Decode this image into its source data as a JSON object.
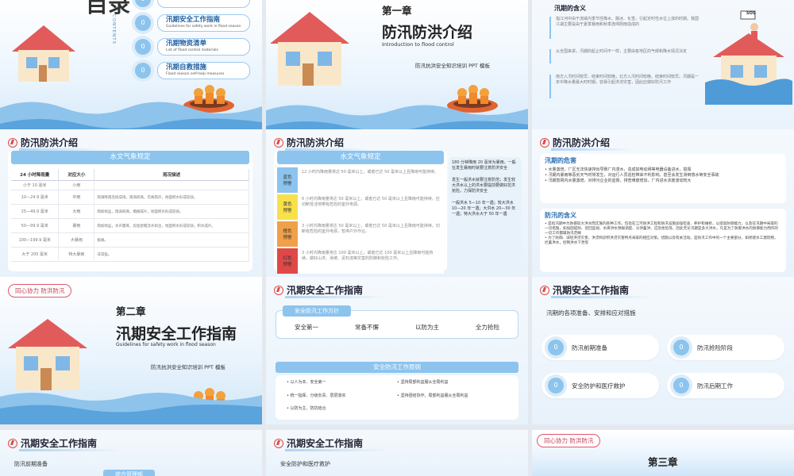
{
  "s1": {
    "title": "目录",
    "contents": "CONTENTS",
    "items": [
      {
        "n": "0",
        "t": "",
        "s": "Introduction to flood control"
      },
      {
        "n": "0",
        "t": "汛期安全工作指南",
        "s": "Guidelines for safety work in flood season"
      },
      {
        "n": "0",
        "t": "汛期物资清单",
        "s": "List of flood control materials"
      },
      {
        "n": "0",
        "t": "汛期自救措施",
        "s": "Flood season self-help measures"
      }
    ]
  },
  "s2": {
    "chapter": "第一章",
    "title": "防汛防洪介绍",
    "sub": "Introduction to flood control",
    "tag": "防汛抗洪安全知识培训 PPT 模板"
  },
  "s3": {
    "head": "汛期的含义",
    "sos": "SOS",
    "paras": [
      "指江河中由于流域内季节性降水、融冰、化雪，引起定时性水位上涨的时期。我国江湖主要是由于夏季暴雨和秋季连绵阴雨造成的",
      "从全国来讲，汛期的起止时间不一样，主要由各地区的气候和降水情况决定",
      "南方入汛时间较早、结束时间较晚，北方入汛时间较晚、结束时间较早。汛期是一年中降水量最大时时期，容易引起洪涝灾害，因此应做好防汛工作"
    ]
  },
  "s4": {
    "head": "防汛防洪介绍",
    "bar": "水文气象规定",
    "cols": [
      "24 小时降雨量",
      "对应大小",
      "雨况描述"
    ],
    "rows": [
      [
        "小于 10 毫米",
        "小雨",
        ""
      ],
      [
        "10—24.9 毫米",
        "中雨",
        "雨滴降落连续成线，雨滴四溅，可闻雨声，地面积水形成较快。"
      ],
      [
        "25—49.9 毫米",
        "大雨",
        "雨如倾盆，雨滴四溅，模糊成片，地面积水形成较快。"
      ],
      [
        "50—99.9 毫米",
        "暴雨",
        "雨如倾盆，水声震耳，房屋屋檐流水如注，地面积水形成较快，积水成片。"
      ],
      [
        "100—199.9 毫米",
        "大暴雨",
        "极端。"
      ],
      [
        "大于 200 毫米",
        "特大暴雨",
        "非常猛。"
      ]
    ]
  },
  "s5": {
    "head": "防汛防洪介绍",
    "bar": "水文气象规定",
    "levels": [
      {
        "c": "蓝色\n预警",
        "col": "#8cc4ee",
        "t": "12 小时内降雨量将达 50 毫米以上，或者已达 50 毫米以上且降雨可能持续。"
      },
      {
        "c": "黄色\n预警",
        "col": "#f8e04a",
        "t": "6 小时内降雨量将达 50 毫米以上，或者已达 50 毫米以上且降雨可能持续。应切断低洼地带有危险的室外电源。"
      },
      {
        "c": "橙色\n预警",
        "col": "#f0a04a",
        "t": "3 小时内降雨量将达 50 毫米以上，或者已达 50 毫米以上且降雨可能持续。切断有危险的室外电源，暂停户外作业。"
      },
      {
        "c": "红色\n预警",
        "col": "#e04848",
        "t": "3 小时内降雨量将达 100 毫米以上，或者已达 100 毫米以上且降雨可能持续。做好山洪、滑坡、泥石流等灾害的防御和抢险工作。"
      }
    ],
    "side": [
      "180 分钟降雨 20 毫米为暴雨，一般在发生暴雨时就要注意防洪安全",
      "发生一般洪水就要注意防范；发生较大洪水以上的洪水要提前要做好抗洪抢险，力保防洪安全",
      "一般洪水 5—10 年一遇；较大洪水 10—20 年一遇；大洪水 20—30 年一遇；特大洪水大于 50 年一遇"
    ]
  },
  "s6": {
    "head": "防汛防洪介绍",
    "h1": "汛期的危害",
    "b1": [
      "水量激增，厂区无法快速排出导致厂内漫水，造成如电动闸等电器设备进水，损毁",
      "汛期内暴雨等恶劣天气时常发生，对运行人员巡检带来不利影响，甚至会发生滑倒落水等安全事故",
      "汛期暂网内水量激增，对排污企业的监督，排查难度增加，厂内进水浓度波动较大"
    ],
    "h2": "防汛的含义",
    "b2": [
      "是指汛期中为防御较大洪水而实施的各种工作，包括在江河防洪工程和防汛设施加强检查、养护和维修，以提高防御能力，以及在汛期中采取的一切措施，如加固堤防、巡回监视、水库洪水预报调度、分洪蓄洪、应急抢险等。因此无论汛期是多大洪水，凡是为了防御洪水的防御能力而作的一切工作都属防汛范畴",
      "为了防御、减轻洪涝灾害，洪涝和淤积洪涝灾害特点采取的相应对策。措施以及有关活动。是防汛工作中的一个主要部分，如修建水工建筑物，拦蓄洪水，控制洪水下泄等"
    ]
  },
  "s7": {
    "pill": "同心协力 防洪防汛",
    "chapter": "第二章",
    "title": "汛期安全工作指南",
    "sub": "Guidelines for safety work in flood season",
    "tag": "防汛抗洪安全知识培训 PPT 模板"
  },
  "s8": {
    "head": "汛期安全工作指南",
    "pg": "安全防汛工作方针",
    "pgs": [
      "安全第一",
      "常备不懈",
      "以防为主",
      "全力抢险"
    ],
    "pr": "安全防汛工作原则",
    "prs": [
      "以人为本、安全第一",
      "坚持局部利益服从全局利益",
      "统一指挥、分级负责、层层落实",
      "坚持团结协作，局部利益服从全局利益",
      "以防为主、防抗结合"
    ]
  },
  "s9": {
    "head": "汛期安全工作指南",
    "lead": "汛期的各项准备、安排和应对措施",
    "opts": [
      {
        "n": "0",
        "t": "防汛前期准备"
      },
      {
        "n": "0",
        "t": "防汛抢险阶段"
      },
      {
        "n": "0",
        "t": "安全防护和医疗救护"
      },
      {
        "n": "0",
        "t": "防汛后期工作"
      }
    ]
  },
  "s10": {
    "head": "汛期安全工作指南",
    "sub": "防汛前期准备",
    "bar": "综合管理部"
  },
  "s11": {
    "head": "汛期安全工作指南",
    "sub": "安全防护和医疗救护"
  },
  "s12": {
    "pill": "同心协力 防洪防汛",
    "chapter": "第三章"
  }
}
